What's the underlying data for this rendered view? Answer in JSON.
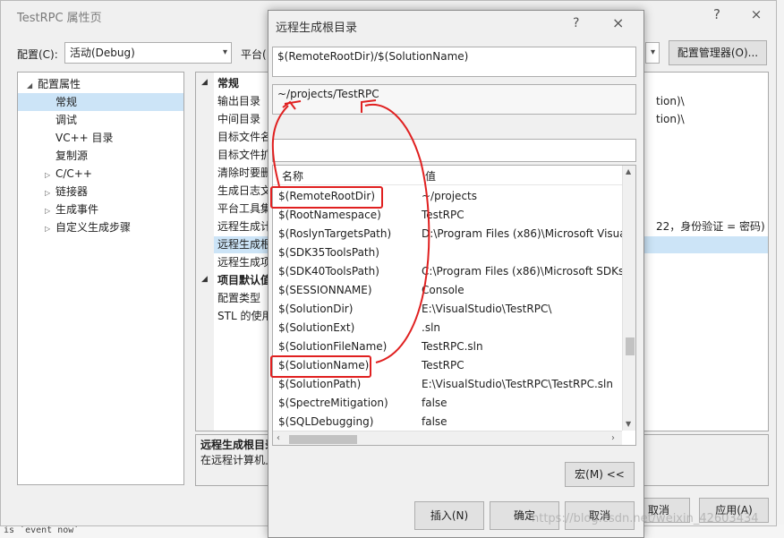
{
  "background": {
    "bottom_text": "is `event now`"
  },
  "prop_window": {
    "title": "TestRPC 属性页",
    "help_glyph": "?",
    "close_glyph": "×",
    "config_label": "配置(C):",
    "config_value": "活动(Debug)",
    "platform_label": "平台(",
    "config_manager_label": "配置管理器(O)...",
    "tree": [
      {
        "label": "配置属性",
        "expander": "◢",
        "indent": 0
      },
      {
        "label": "常规",
        "expander": "",
        "indent": 1,
        "selected": true
      },
      {
        "label": "调试",
        "expander": "",
        "indent": 1
      },
      {
        "label": "VC++ 目录",
        "expander": "",
        "indent": 1
      },
      {
        "label": "复制源",
        "expander": "",
        "indent": 1
      },
      {
        "label": "C/C++",
        "expander": "▷",
        "indent": 1
      },
      {
        "label": "链接器",
        "expander": "▷",
        "indent": 1
      },
      {
        "label": "生成事件",
        "expander": "▷",
        "indent": 1
      },
      {
        "label": "自定义生成步骤",
        "expander": "▷",
        "indent": 1
      }
    ],
    "grid": [
      {
        "name": "常规",
        "value": "",
        "cat": true
      },
      {
        "name": "输出目录",
        "value": "tion)\\"
      },
      {
        "name": "中间目录",
        "value": "tion)\\"
      },
      {
        "name": "目标文件名",
        "value": ""
      },
      {
        "name": "目标文件扩",
        "value": ""
      },
      {
        "name": "清除时要删",
        "value": ""
      },
      {
        "name": "生成日志文",
        "value": ""
      },
      {
        "name": "平台工具集",
        "value": ""
      },
      {
        "name": "远程生成计",
        "value": "22，身份验证 = 密码)"
      },
      {
        "name": "远程生成根",
        "value": "",
        "selected": true
      },
      {
        "name": "远程生成项",
        "value": ""
      },
      {
        "name": "项目默认值",
        "value": "",
        "cat": true
      },
      {
        "name": "配置类型",
        "value": ""
      },
      {
        "name": "STL 的使用",
        "value": ""
      }
    ],
    "desc_title": "远程生成根目录",
    "desc_text": "在远程计算机上",
    "ok_label": "确定",
    "cancel_label": "取消",
    "apply_label": "应用(A)"
  },
  "macro_dialog": {
    "title": "远程生成根目录",
    "help_glyph": "?",
    "close_glyph": "×",
    "edit_value": "$(RemoteRootDir)/$(SolutionName)",
    "evaluated_value": "~/projects/TestRPC",
    "filter_value": "",
    "col_name": "名称",
    "col_value": "值",
    "macros": [
      {
        "name": "$(RemoteRootDir)",
        "value": "~/projects"
      },
      {
        "name": "$(RootNamespace)",
        "value": "TestRPC"
      },
      {
        "name": "$(RoslynTargetsPath)",
        "value": "D:\\Program Files (x86)\\Microsoft Visua"
      },
      {
        "name": "$(SDK35ToolsPath)",
        "value": ""
      },
      {
        "name": "$(SDK40ToolsPath)",
        "value": "C:\\Program Files (x86)\\Microsoft SDKs"
      },
      {
        "name": "$(SESSIONNAME)",
        "value": "Console"
      },
      {
        "name": "$(SolutionDir)",
        "value": "E:\\VisualStudio\\TestRPC\\"
      },
      {
        "name": "$(SolutionExt)",
        "value": ".sln"
      },
      {
        "name": "$(SolutionFileName)",
        "value": "TestRPC.sln"
      },
      {
        "name": "$(SolutionName)",
        "value": "TestRPC"
      },
      {
        "name": "$(SolutionPath)",
        "value": "E:\\VisualStudio\\TestRPC\\TestRPC.sln"
      },
      {
        "name": "$(SpectreMitigation)",
        "value": "false"
      },
      {
        "name": "$(SQLDebugging)",
        "value": "false"
      }
    ],
    "macros_button_label": "宏(M) <<",
    "insert_label": "插入(N)",
    "ok_label": "确定",
    "cancel_label": "取消"
  },
  "watermark": "https://blog.csdn.net/weixin_42603434",
  "colors": {
    "annotation": "#e02020",
    "selection": "#cce4f7"
  }
}
